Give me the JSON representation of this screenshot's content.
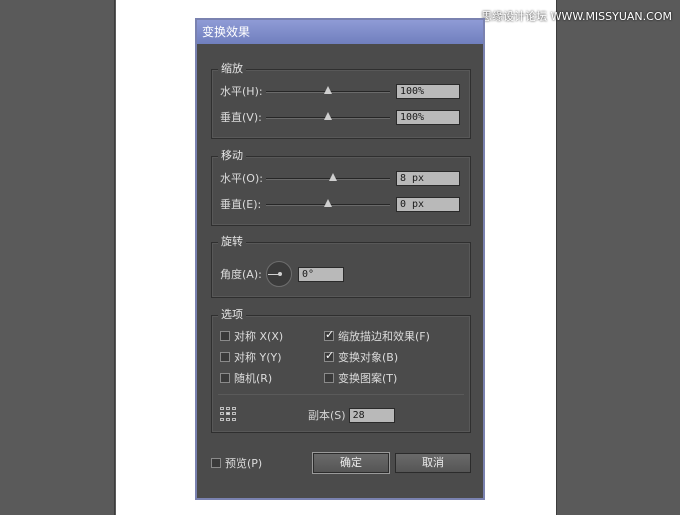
{
  "watermark": "思缘设计论坛 WWW.MISSYUAN.COM",
  "dialog": {
    "title": "变换效果",
    "scale": {
      "title": "缩放",
      "horizontal": {
        "label": "水平(H):",
        "value": "100%",
        "slider": 0.5
      },
      "vertical": {
        "label": "垂直(V):",
        "value": "100%",
        "slider": 0.5
      }
    },
    "move": {
      "title": "移动",
      "horizontal": {
        "label": "水平(O):",
        "value": "8 px",
        "slider": 0.54
      },
      "vertical": {
        "label": "垂直(E):",
        "value": "0 px",
        "slider": 0.5
      }
    },
    "rotate": {
      "title": "旋转",
      "angle": {
        "label": "角度(A):",
        "value": "0°"
      }
    },
    "options": {
      "title": "选项",
      "reflect_x": {
        "label": "对称 X(X)",
        "checked": false
      },
      "reflect_y": {
        "label": "对称 Y(Y)",
        "checked": false
      },
      "random": {
        "label": "随机(R)",
        "checked": false
      },
      "scale_strokes": {
        "label": "缩放描边和效果(F)",
        "checked": true
      },
      "transform_objects": {
        "label": "变换对象(B)",
        "checked": true
      },
      "transform_patterns": {
        "label": "变换图案(T)",
        "checked": false
      },
      "copies": {
        "label": "副本(S)",
        "value": "28"
      }
    },
    "preview": {
      "label": "预览(P)",
      "checked": false
    },
    "ok_label": "确定",
    "cancel_label": "取消"
  }
}
